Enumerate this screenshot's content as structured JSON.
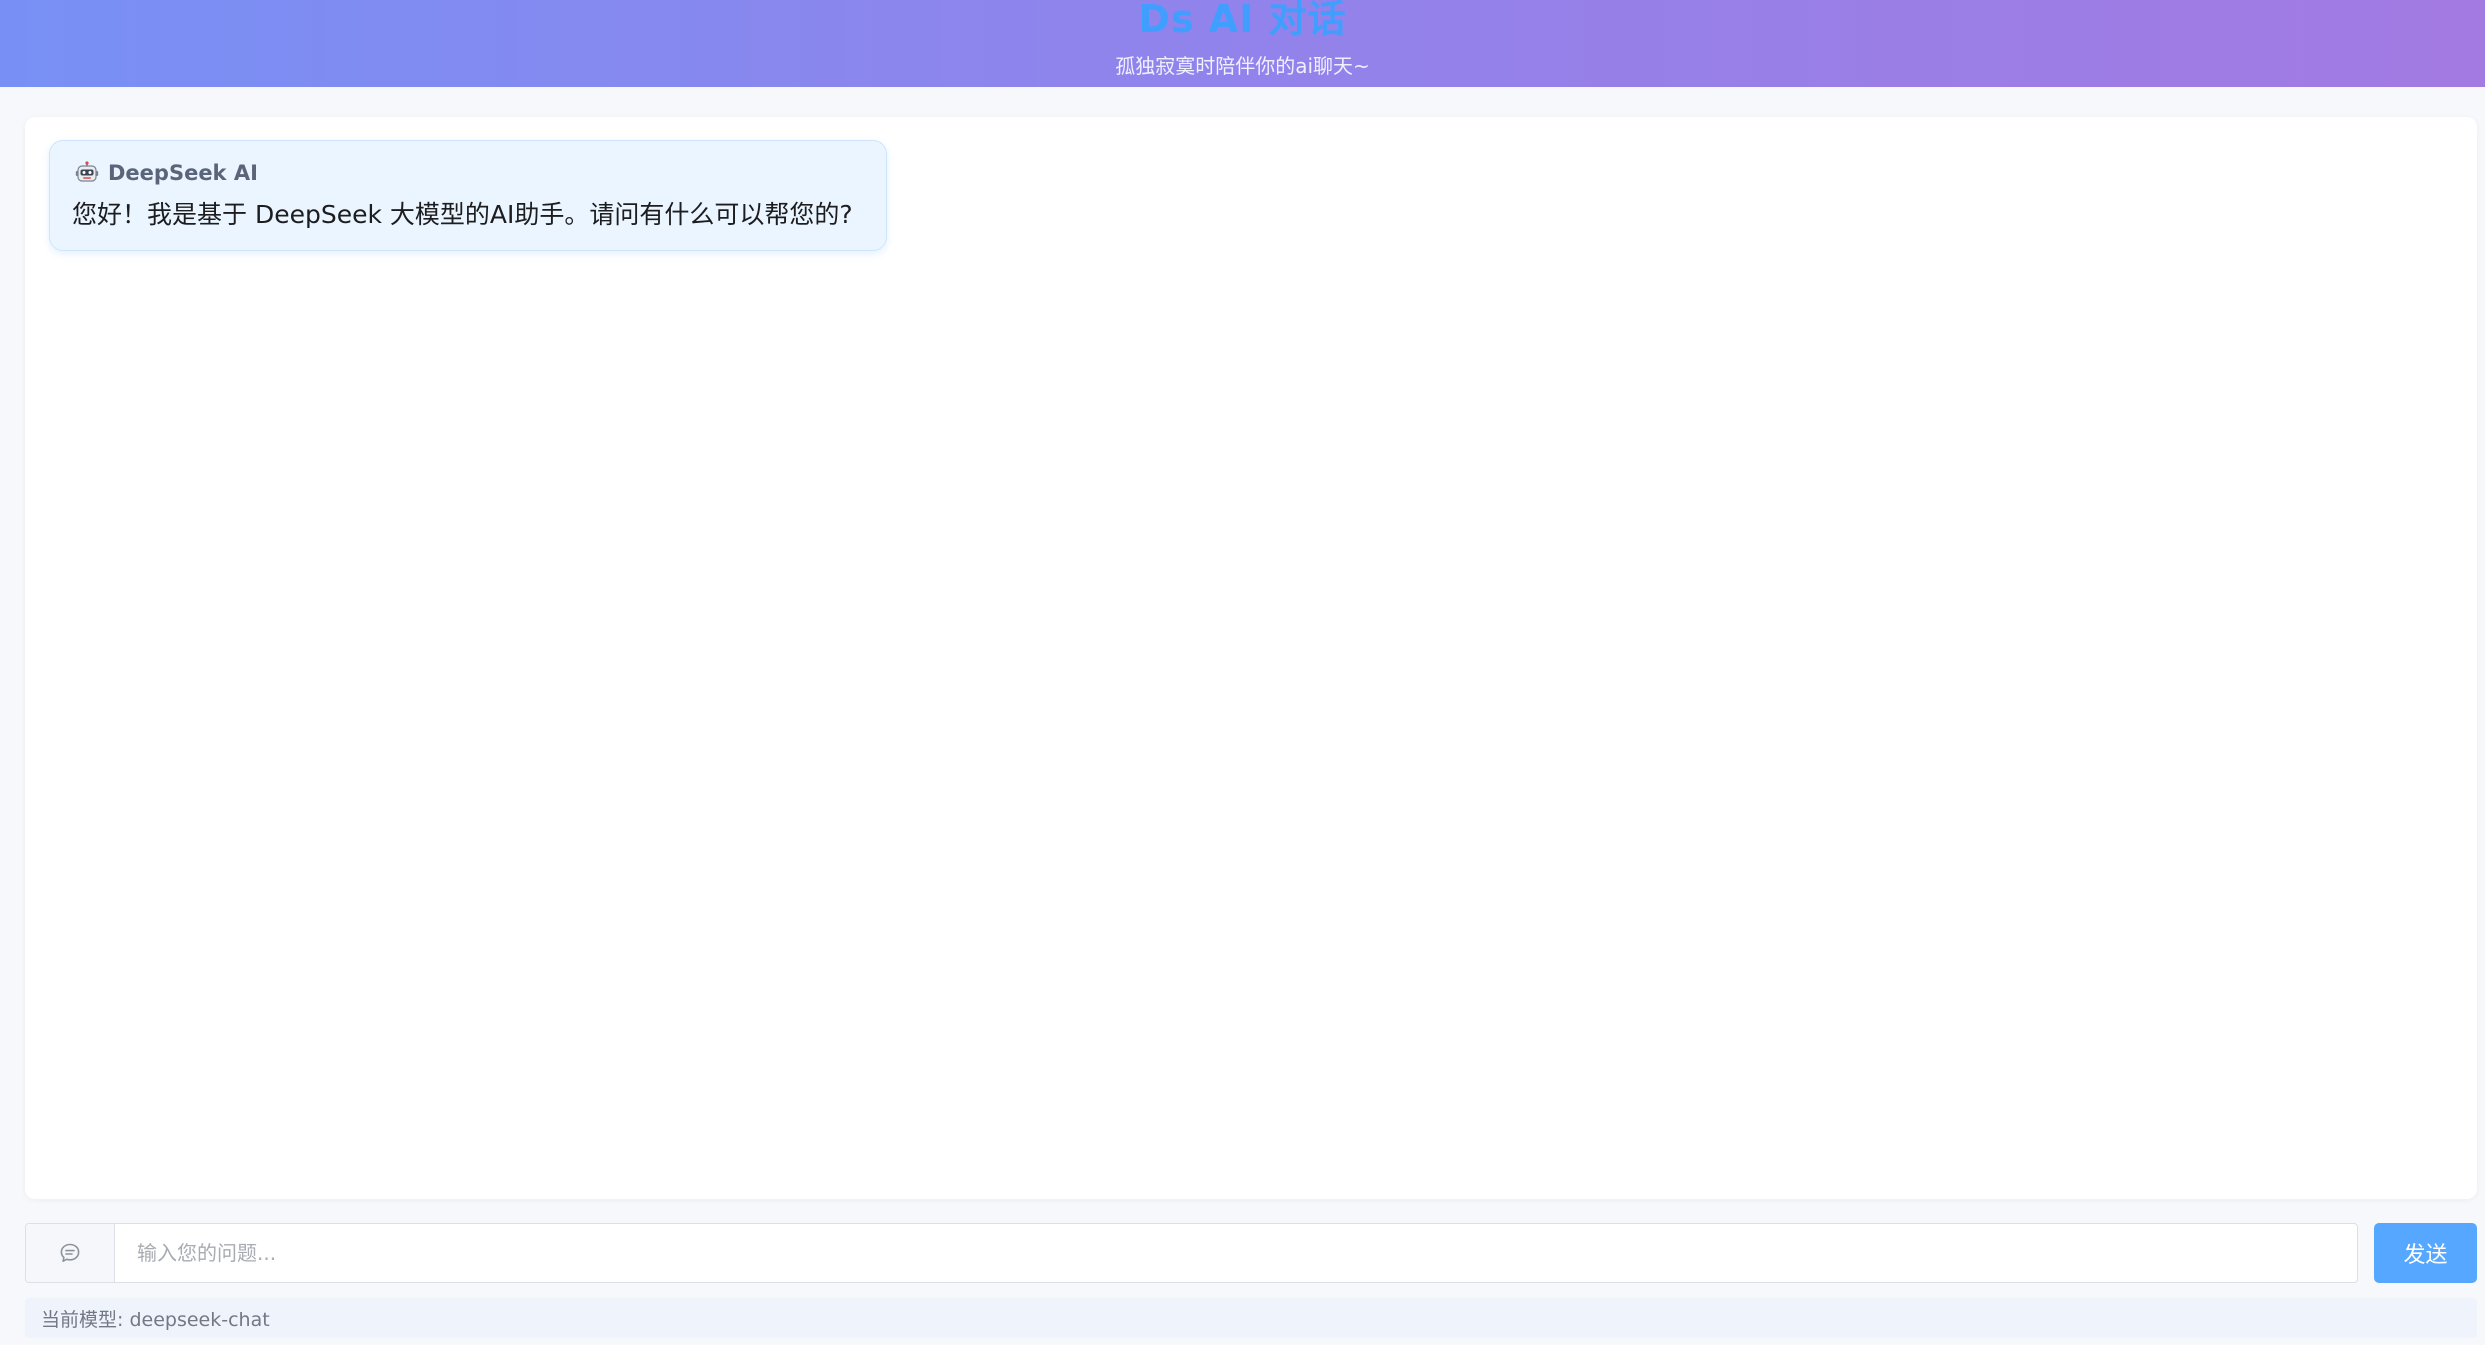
{
  "header": {
    "title": "Ds AI 对话",
    "subtitle": "孤独寂寞时陪伴你的ai聊天~"
  },
  "messages": [
    {
      "sender": "DeepSeek AI",
      "avatar_icon": "robot-icon",
      "text": "您好！我是基于 DeepSeek 大模型的AI助手。请问有什么可以帮您的?"
    }
  ],
  "composer": {
    "prefix_icon": "chat-bubble-icon",
    "value": "",
    "placeholder": "输入您的问题...",
    "send_label": "发送"
  },
  "footer": {
    "model_text": "当前模型: deepseek-chat"
  },
  "colors": {
    "accent": "#409eff",
    "send_button": "#56a7ff",
    "bubble_bg": "#eaf5ff",
    "header_gradient_start": "#7890f5",
    "header_gradient_end": "#a27ae2"
  }
}
